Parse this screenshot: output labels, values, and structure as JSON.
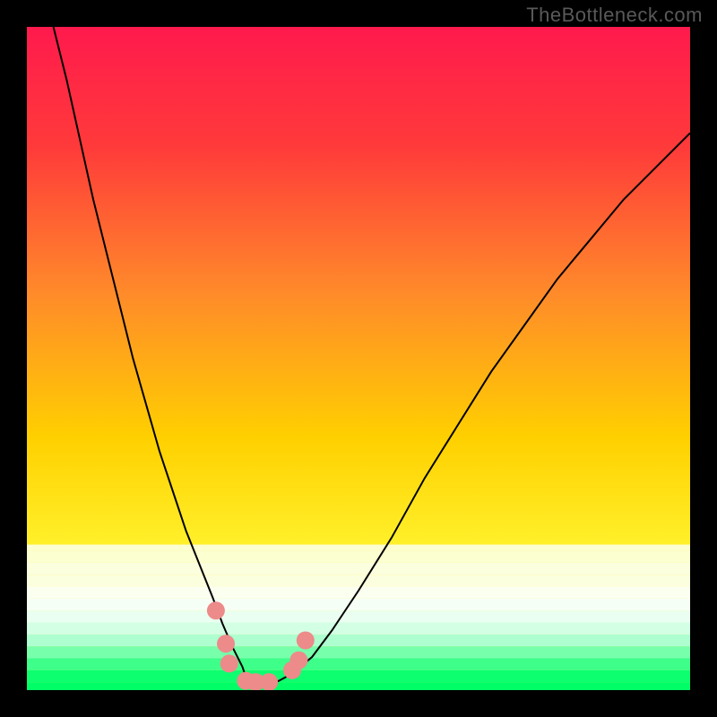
{
  "watermark": "TheBottleneck.com",
  "chart_data": {
    "type": "line",
    "title": "",
    "xlabel": "",
    "ylabel": "",
    "xlim": [
      0,
      100
    ],
    "ylim": [
      0,
      100
    ],
    "grid": false,
    "background_gradient": {
      "top_color": "#ff1a4d",
      "mid_color": "#ffe600",
      "bottom_color": "#ffff66",
      "bottom_bands": [
        {
          "y_frac": 0.79,
          "color": "#fcffd0"
        },
        {
          "y_frac": 0.808,
          "color": "#fcffd0"
        },
        {
          "y_frac": 0.826,
          "color": "#fcffde"
        },
        {
          "y_frac": 0.844,
          "color": "#fcffde"
        },
        {
          "y_frac": 0.862,
          "color": "#fbfff0"
        },
        {
          "y_frac": 0.88,
          "color": "#f6fff5"
        },
        {
          "y_frac": 0.898,
          "color": "#eafff1"
        },
        {
          "y_frac": 0.916,
          "color": "#d3ffe5"
        },
        {
          "y_frac": 0.934,
          "color": "#aeffd0"
        },
        {
          "y_frac": 0.952,
          "color": "#77ffac"
        },
        {
          "y_frac": 0.97,
          "color": "#3eff8a"
        },
        {
          "y_frac": 0.988,
          "color": "#0dff70"
        },
        {
          "y_frac": 1.0,
          "color": "#00ff66"
        }
      ]
    },
    "series": [
      {
        "name": "curve",
        "color": "#000000",
        "width": 2,
        "x": [
          4,
          6,
          8,
          10,
          12,
          14,
          16,
          18,
          20,
          22,
          24,
          26,
          28,
          29.5,
          31,
          32.5,
          33,
          34,
          35,
          37,
          38,
          40,
          43,
          46,
          50,
          55,
          60,
          65,
          70,
          75,
          80,
          85,
          90,
          95,
          100
        ],
        "y": [
          100,
          92,
          83,
          74,
          66,
          58,
          50,
          43,
          36,
          30,
          24,
          19,
          14,
          10,
          6.5,
          3.5,
          2,
          1.4,
          1,
          1,
          1.4,
          2.5,
          5,
          9,
          15,
          23,
          32,
          40,
          48,
          55,
          62,
          68,
          74,
          79,
          84
        ]
      }
    ],
    "markers": {
      "name": "dots",
      "color": "#ed8a8a",
      "radius": 10,
      "points": [
        {
          "x": 28.5,
          "y": 12
        },
        {
          "x": 30.0,
          "y": 7
        },
        {
          "x": 30.5,
          "y": 4
        },
        {
          "x": 33.0,
          "y": 1.4
        },
        {
          "x": 34.5,
          "y": 1.2
        },
        {
          "x": 36.5,
          "y": 1.2
        },
        {
          "x": 40.0,
          "y": 3.0
        },
        {
          "x": 41.0,
          "y": 4.5
        },
        {
          "x": 42.0,
          "y": 7.5
        }
      ]
    }
  }
}
